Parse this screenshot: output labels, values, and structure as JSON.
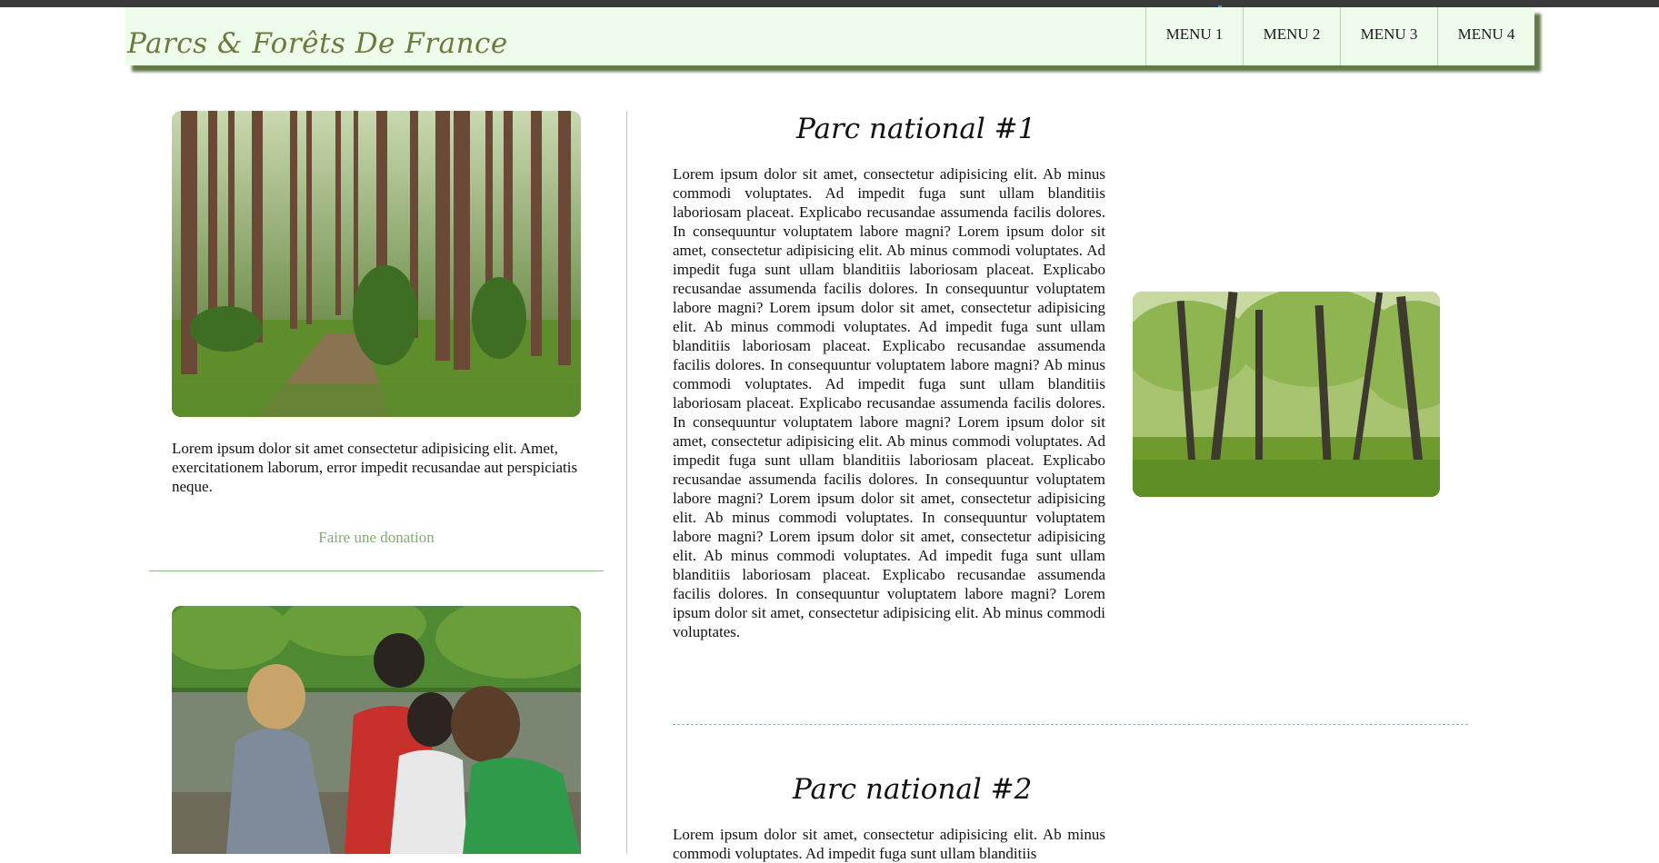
{
  "header": {
    "logo": "Parcs & Forêts De France",
    "menu": [
      "MENU 1",
      "MENU 2",
      "MENU 3",
      "MENU 4"
    ]
  },
  "sidebar": {
    "text": "Lorem ipsum dolor sit amet consectetur adipisicing elit. Amet, exercitationem laborum, error impedit recusandae aut perspiciatis neque.",
    "donate_label": "Faire une donation"
  },
  "parks": [
    {
      "title": "Parc national #1",
      "text": "Lorem ipsum dolor sit amet, consectetur adipisicing elit. Ab minus commodi voluptates. Ad impedit fuga sunt ullam blanditiis laboriosam placeat. Explicabo recusandae assumenda facilis dolores. In consequuntur voluptatem labore magni? Lorem ipsum dolor sit amet, consectetur adipisicing elit. Ab minus commodi voluptates. Ad impedit fuga sunt ullam blanditiis laboriosam placeat. Explicabo recusandae assumenda facilis dolores. In consequuntur voluptatem labore magni? Lorem ipsum dolor sit amet, consectetur adipisicing elit. Ab minus commodi voluptates. Ad impedit fuga sunt ullam blanditiis laboriosam placeat. Explicabo recusandae assumenda facilis dolores. In consequuntur voluptatem labore magni? Ab minus commodi voluptates. Ad impedit fuga sunt ullam blanditiis laboriosam placeat. Explicabo recusandae assumenda facilis dolores. In consequuntur voluptatem labore magni? Lorem ipsum dolor sit amet, consectetur adipisicing elit. Ab minus commodi voluptates. Ad impedit fuga sunt ullam blanditiis laboriosam placeat. Explicabo recusandae assumenda facilis dolores. In consequuntur voluptatem labore magni? Lorem ipsum dolor sit amet, consectetur adipisicing elit. Ab minus commodi voluptates. In consequuntur voluptatem labore magni? Lorem ipsum dolor sit amet, consectetur adipisicing elit. Ab minus commodi voluptates. Ad impedit fuga sunt ullam blanditiis laboriosam placeat. Explicabo recusandae assumenda facilis dolores. In consequuntur voluptatem labore magni? Lorem ipsum dolor sit amet, consectetur adipisicing elit. Ab minus commodi voluptates."
    },
    {
      "title": "Parc national #2",
      "text": "Lorem ipsum dolor sit amet, consectetur adipisicing elit. Ab minus commodi voluptates. Ad impedit fuga sunt ullam blanditiis"
    }
  ],
  "colors": {
    "header_bg": "#eefcec",
    "header_shadow": "#647a4a",
    "logo": "#6c7a3d",
    "donate_link": "#7fae6f",
    "divider": "#8fb98a"
  }
}
